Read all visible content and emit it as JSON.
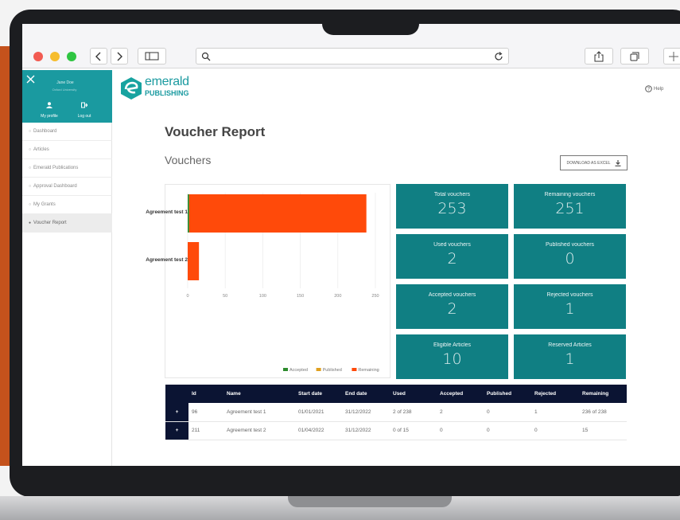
{
  "sidebar": {
    "user_name": "Jane Doe",
    "user_org": "Oxford University",
    "my_profile": "My profile",
    "log_out": "Log out",
    "items": [
      {
        "label": "Dashboard",
        "active": false
      },
      {
        "label": "Articles",
        "active": false
      },
      {
        "label": "Emerald Publications",
        "active": false
      },
      {
        "label": "Approval Dashboard",
        "active": false
      },
      {
        "label": "My Grants",
        "active": false
      },
      {
        "label": "Voucher Report",
        "active": true
      }
    ]
  },
  "header": {
    "logo_top": "emerald",
    "logo_bottom": "PUBLISHING",
    "help": "Help"
  },
  "page_title": "Voucher Report",
  "section_title": "Vouchers",
  "download_label": "DOWNLOAD AS EXCEL",
  "cards": [
    {
      "label": "Total vouchers",
      "value": "253"
    },
    {
      "label": "Remaining vouchers",
      "value": "251"
    },
    {
      "label": "Used vouchers",
      "value": "2"
    },
    {
      "label": "Published vouchers",
      "value": "0"
    },
    {
      "label": "Accepted vouchers",
      "value": "2"
    },
    {
      "label": "Rejected vouchers",
      "value": "1"
    },
    {
      "label": "Eligible Articles",
      "value": "10"
    },
    {
      "label": "Reserved Articles",
      "value": "1"
    }
  ],
  "chart_data": {
    "type": "bar",
    "orientation": "horizontal",
    "stacked": true,
    "categories": [
      "Agreement test 1",
      "Agreement test 2"
    ],
    "series": [
      {
        "name": "Accepted",
        "color": "#2e8b2e",
        "values": [
          2,
          0
        ]
      },
      {
        "name": "Published",
        "color": "#e0a020",
        "values": [
          0,
          0
        ]
      },
      {
        "name": "Remaining",
        "color": "#ff4a0a",
        "values": [
          236,
          15
        ]
      }
    ],
    "xticks": [
      "0",
      "50",
      "100",
      "150",
      "200",
      "250"
    ],
    "xlim": [
      0,
      250
    ],
    "grid": true,
    "legend": "bottom-right"
  },
  "table": {
    "columns": [
      "Id",
      "Name",
      "Start date",
      "End date",
      "Used",
      "Accepted",
      "Published",
      "Rejected",
      "Remaining"
    ],
    "rows": [
      [
        "96",
        "Agreement test 1",
        "01/01/2021",
        "31/12/2022",
        "2 of 238",
        "2",
        "0",
        "1",
        "236 of 238"
      ],
      [
        "211",
        "Agreement test 2",
        "01/04/2022",
        "31/12/2022",
        "0 of 15",
        "0",
        "0",
        "0",
        "15"
      ]
    ],
    "expand_icon": "plus-icon"
  }
}
